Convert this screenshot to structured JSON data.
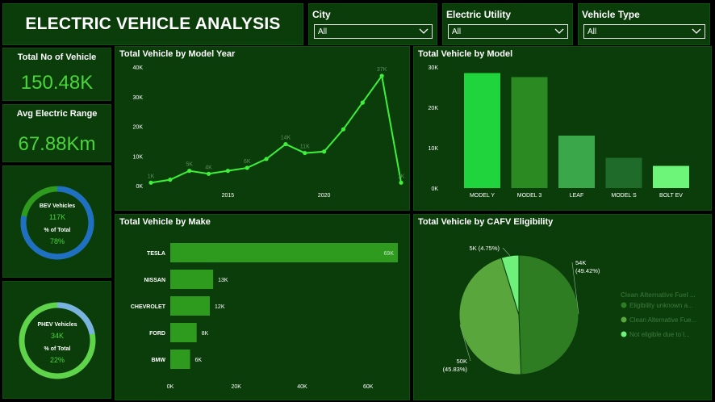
{
  "header": {
    "title": "ELECTRIC VEHICLE ANALYSIS"
  },
  "slicers": [
    {
      "label": "City",
      "value": "All"
    },
    {
      "label": "Electric Utility",
      "value": "All"
    },
    {
      "label": "Vehicle Type",
      "value": "All"
    }
  ],
  "kpis": {
    "total_vehicles": {
      "label": "Total No of Vehicle",
      "value": "150.48K"
    },
    "avg_range": {
      "label": "Avg Electric Range",
      "value": "67.88Km"
    }
  },
  "donuts": {
    "bev": {
      "title": "BEV Vehicles",
      "count": "117K",
      "pct_label": "% of Total",
      "pct": "78%",
      "fraction": 0.78,
      "color_main": "#1f6fc2",
      "color_rest": "#2e9a1e"
    },
    "phev": {
      "title": "PHEV Vehicles",
      "count": "34K",
      "pct_label": "% of Total",
      "pct": "22%",
      "fraction": 0.22,
      "color_main": "#7ab3e0",
      "color_rest": "#5fd34a"
    }
  },
  "colors": {
    "panel": "#0b3d0b",
    "accent": "#4cd43c",
    "line": "#3ef03a"
  },
  "chart_data": [
    {
      "id": "model_year",
      "type": "line",
      "title": "Total Vehicle by Model Year",
      "x": [
        2011,
        2012,
        2013,
        2014,
        2015,
        2016,
        2017,
        2018,
        2019,
        2020,
        2021,
        2022,
        2023,
        2024
      ],
      "values": [
        1,
        2,
        5,
        4,
        5,
        6,
        9,
        14,
        11,
        11.5,
        19,
        28,
        37,
        1
      ],
      "data_labels": {
        "0": "1K",
        "2": "5K",
        "3": "4K",
        "5": "6K",
        "7": "14K",
        "8": "11K",
        "12": "37K",
        "13": "1K"
      },
      "yticks": [
        "0K",
        "10K",
        "20K",
        "30K",
        "40K"
      ],
      "ytick_values": [
        0,
        10,
        20,
        30,
        40
      ],
      "xticks": [
        "2015",
        "2020"
      ],
      "xtick_values": [
        2015,
        2020
      ],
      "ylim": [
        0,
        40
      ]
    },
    {
      "id": "model",
      "type": "bar",
      "title": "Total Vehicle by Model",
      "categories": [
        "MODEL Y",
        "MODEL 3",
        "LEAF",
        "MODEL S",
        "BOLT EV"
      ],
      "values": [
        28.5,
        27.5,
        13,
        7.5,
        5.5
      ],
      "colors": [
        "#1fd43c",
        "#2b8a22",
        "#3aa84a",
        "#1e6b2a",
        "#6cf578"
      ],
      "yticks": [
        "0K",
        "10K",
        "20K",
        "30K"
      ],
      "ytick_values": [
        0,
        10,
        20,
        30
      ],
      "ylim": [
        0,
        30
      ]
    },
    {
      "id": "make",
      "type": "bar",
      "orientation": "horizontal",
      "title": "Total Vehicle by Make",
      "categories": [
        "TESLA",
        "NISSAN",
        "CHEVROLET",
        "FORD",
        "BMW"
      ],
      "values": [
        69,
        13,
        12,
        8,
        6
      ],
      "value_labels": [
        "69K",
        "13K",
        "12K",
        "8K",
        "6K"
      ],
      "xticks": [
        "0K",
        "20K",
        "40K",
        "60K"
      ],
      "xtick_values": [
        0,
        20,
        40,
        60
      ],
      "xlim": [
        0,
        69
      ]
    },
    {
      "id": "cafv",
      "type": "pie",
      "title": "Total Vehicle by CAFV Eligibility",
      "labels": [
        "Eligibility unknown a...",
        "Clean Alternative Fue...",
        "Not eligible due to l..."
      ],
      "values": [
        49.42,
        45.83,
        4.75
      ],
      "slice_labels": [
        "54K\n(49.42%)",
        "50K\n(45.83%)",
        "5K (4.75%)"
      ],
      "colors": [
        "#2e7d22",
        "#58a63c",
        "#6ef07a"
      ],
      "legend_title": "Clean Alternative Fuel ..."
    }
  ]
}
